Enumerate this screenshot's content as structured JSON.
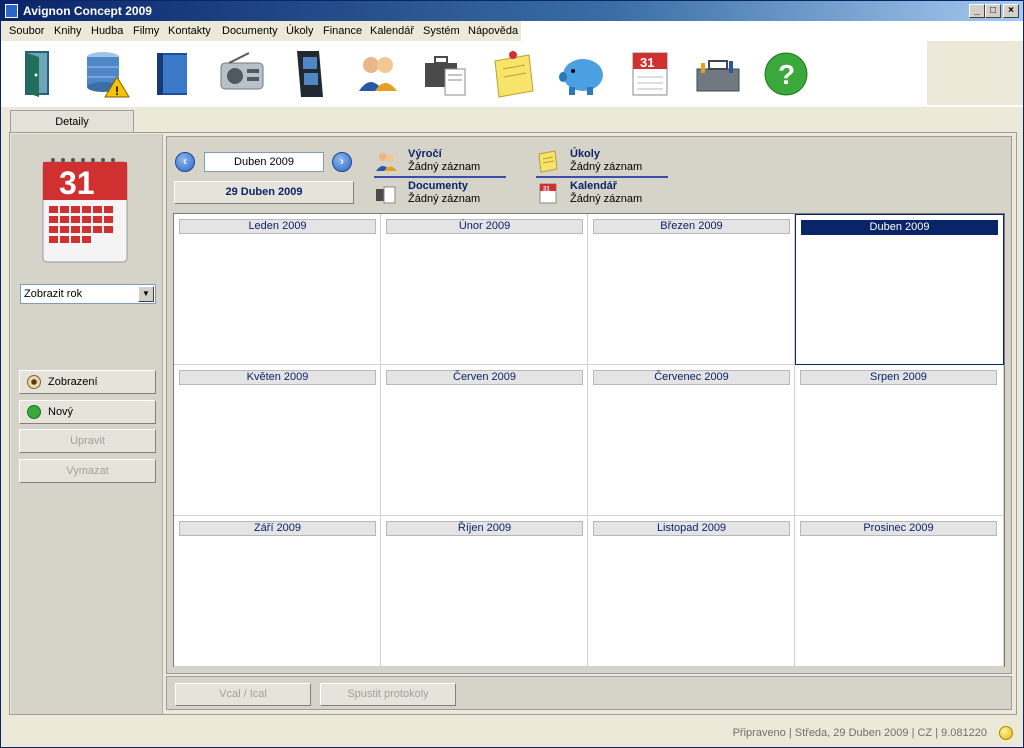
{
  "window": {
    "title": "Avignon Concept 2009"
  },
  "menu": [
    "Soubor",
    "Knihy",
    "Hudba",
    "Filmy",
    "Kontakty",
    "Documenty",
    "Úkoly",
    "Finance",
    "Kalendář",
    "Systém",
    "Nápověda"
  ],
  "toolbar": {
    "icons": [
      "door-exit-icon",
      "database-warning-icon",
      "book-icon",
      "radio-icon",
      "film-icon",
      "contacts-icon",
      "briefcase-documents-icon",
      "notes-icon",
      "piggy-bank-icon",
      "calendar-icon",
      "toolbox-icon",
      "help-icon"
    ]
  },
  "tabs": {
    "details": "Detaily"
  },
  "left": {
    "view_select": "Zobrazit rok",
    "btn_view": "Zobrazení",
    "btn_new": "Nový",
    "btn_edit": "Upravit",
    "btn_delete": "Vymazat"
  },
  "nav": {
    "current_month": "Duben 2009",
    "today_button": "29 Duben 2009"
  },
  "info": [
    {
      "title": "Výročí",
      "sub": "Žádný záznam",
      "icon": "anniversary-icon"
    },
    {
      "title": "Úkoly",
      "sub": "Žádný záznam",
      "icon": "tasks-icon"
    },
    {
      "title": "Documenty",
      "sub": "Žádný záznam",
      "icon": "documents-icon"
    },
    {
      "title": "Kalendář",
      "sub": "Žádný záznam",
      "icon": "calendar-small-icon"
    }
  ],
  "months": [
    "Leden 2009",
    "Únor 2009",
    "Březen 2009",
    "Duben 2009",
    "Květen 2009",
    "Červen 2009",
    "Červenec 2009",
    "Srpen 2009",
    "Září 2009",
    "Říjen 2009",
    "Listopad 2009",
    "Prosinec 2009"
  ],
  "selected_month": "Duben 2009",
  "bottom": {
    "btn_vcal": "Vcal / Ical",
    "btn_protocols": "Spustit protokoly"
  },
  "status": {
    "text": "Připraveno | Středa, 29 Duben 2009  | CZ | 9.081220"
  },
  "colors": {
    "accent": "#0a246a",
    "selected_month": "#0a246a"
  }
}
